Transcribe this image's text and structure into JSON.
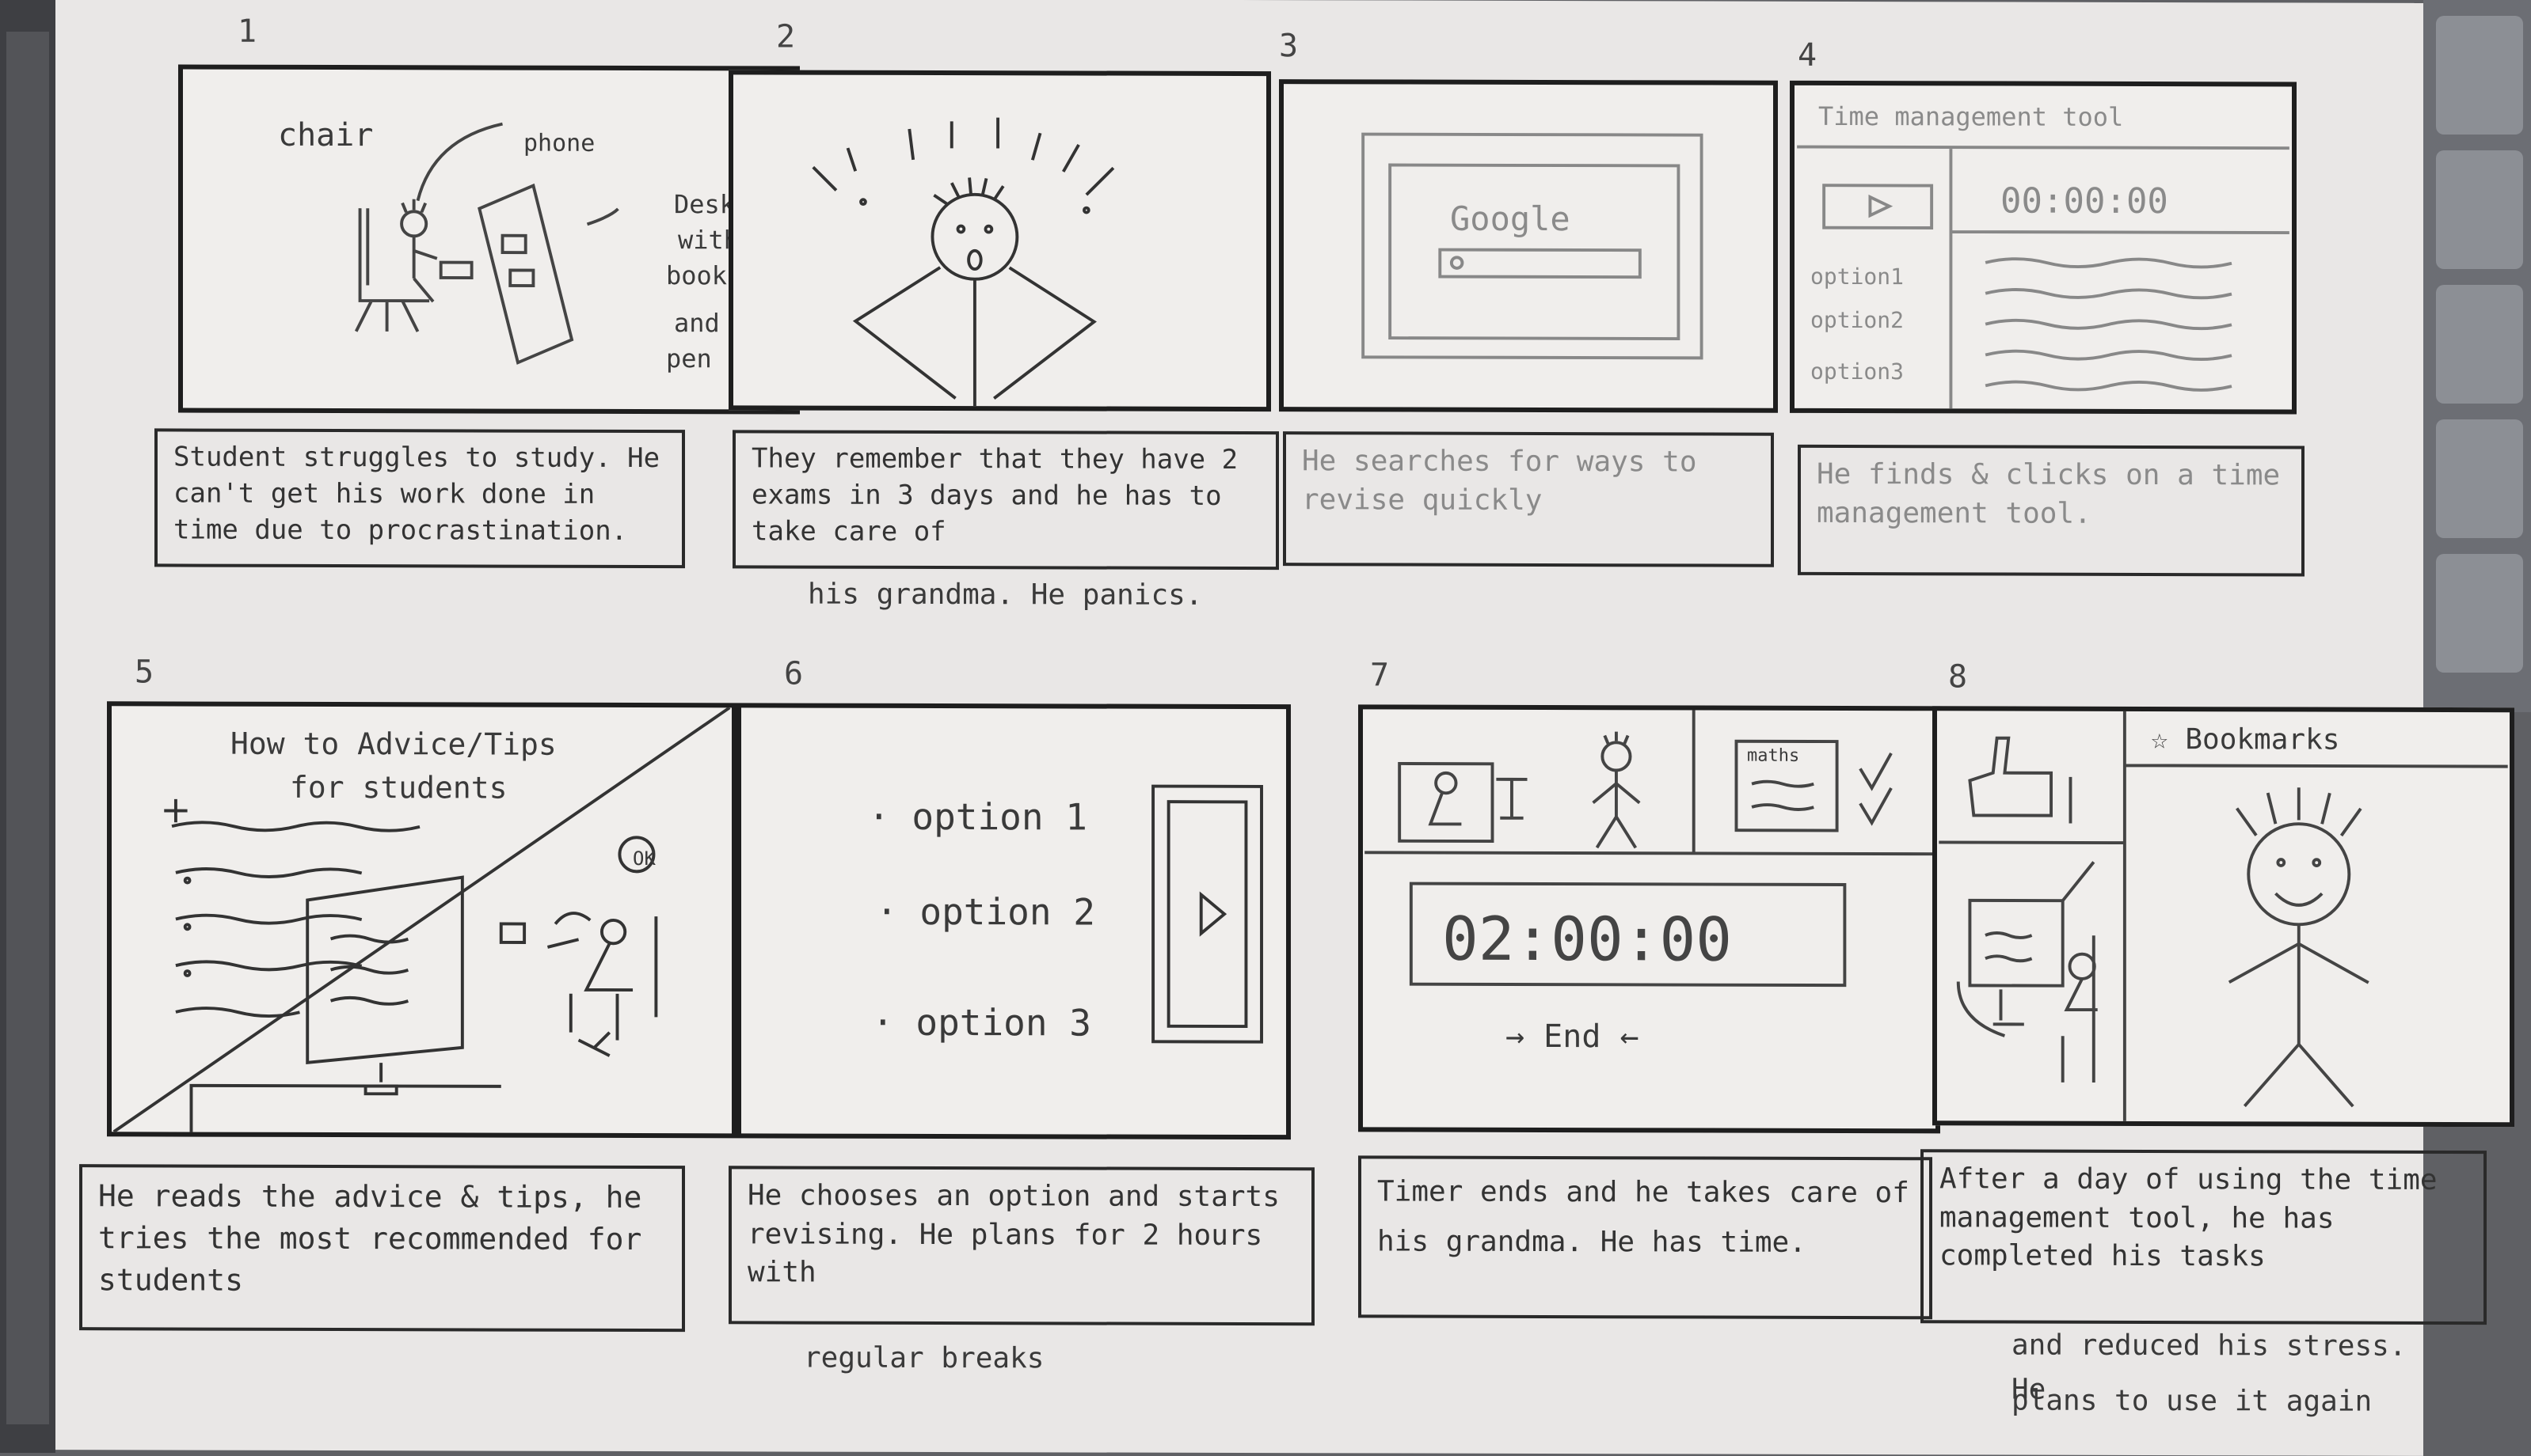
{
  "panels": [
    {
      "number": "1",
      "labels": {
        "chair": "chair",
        "phone": "phone",
        "desk": "Desk",
        "with": "with",
        "books": "books",
        "and": "and",
        "pen": "pen"
      },
      "caption": "Student struggles to study. He can't get his work done in time due to procrastination."
    },
    {
      "number": "2",
      "caption": "They remember that they have 2 exams in 3 days and he has to take care of",
      "caption_continued": "his grandma. He panics."
    },
    {
      "number": "3",
      "browser_logo": "Google",
      "caption": "He searches for ways to revise quickly"
    },
    {
      "number": "4",
      "tool_title": "Time management tool",
      "timer": "00:00:00",
      "options": [
        "option1",
        "option2",
        "option3"
      ],
      "caption": "He finds & clicks on a time management tool."
    },
    {
      "number": "5",
      "heading_line1": "How to Advice/Tips",
      "heading_line2": "for students",
      "bubble": "OK",
      "caption": "He reads the advice & tips, he tries the most recommended for students"
    },
    {
      "number": "6",
      "options": [
        "· option 1",
        "· option 2",
        "· option 3"
      ],
      "caption": "He chooses an option and starts revising. He plans for 2 hours with",
      "caption_continued": "regular breaks"
    },
    {
      "number": "7",
      "note": "maths",
      "timer": "02:00:00",
      "end_label": "→ End ←",
      "caption": "Timer ends and he takes care of his grandma. He has time."
    },
    {
      "number": "8",
      "bookmark": "☆ Bookmarks",
      "caption": "After a day of using the time management tool, he has completed his tasks",
      "caption_continued_1": "and reduced his stress. He",
      "caption_continued_2": "plans to use it again"
    }
  ]
}
